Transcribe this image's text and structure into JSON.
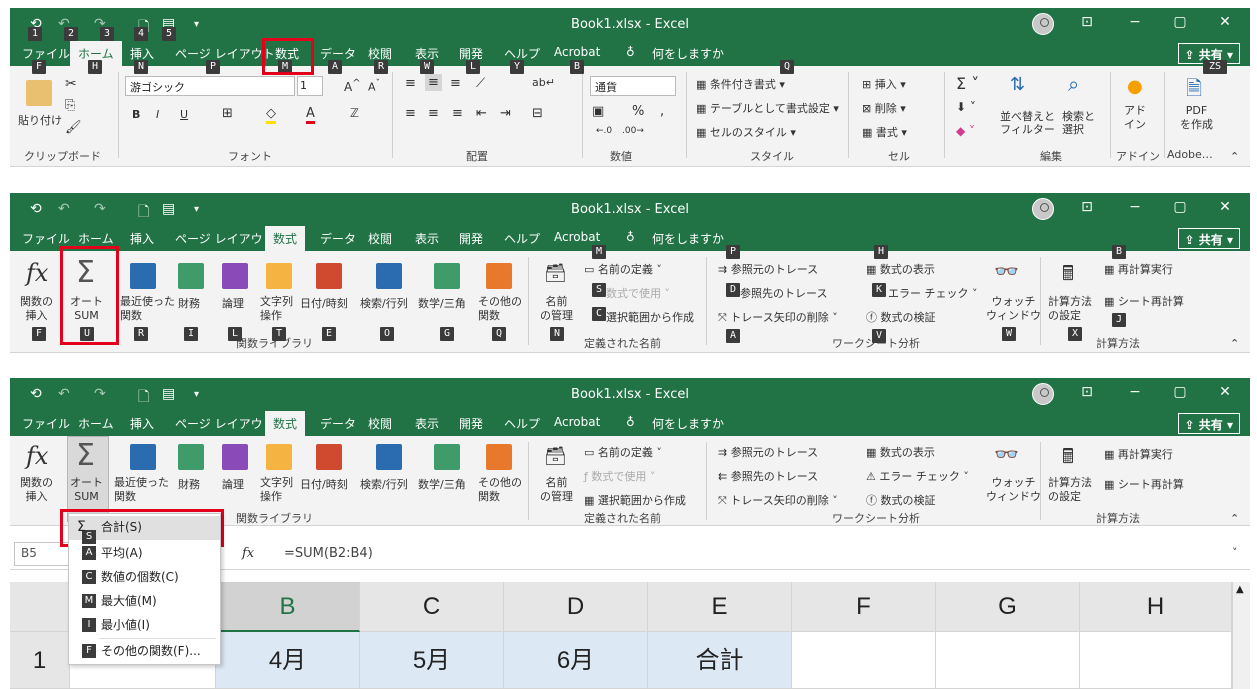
{
  "window": {
    "title": "Book1.xlsx  -  Excel",
    "minimize": "−",
    "restore": "▢",
    "close": "✕",
    "ribbon_display": "⊡",
    "share": "共有"
  },
  "tabs": [
    "ファイル",
    "ホーム",
    "挿入",
    "ページ レイアウト",
    "数式",
    "データ",
    "校閲",
    "表示",
    "開発",
    "ヘルプ",
    "Acrobat"
  ],
  "tell_me": "何をしますか",
  "home": {
    "paste": "貼り付け",
    "font_name": "游ゴシック",
    "font_size": "1",
    "number_format": "通貨",
    "cond_format": "条件付き書式",
    "table_format": "テーブルとして書式設定",
    "cell_style": "セルのスタイル",
    "insert": "挿入",
    "delete": "削除",
    "format": "書式",
    "sort_filter": "並べ替えと\nフィルター",
    "find_select": "検索と\n選択",
    "addin": "アド\nイン",
    "pdf": "PDF\nを作成",
    "groups": [
      "クリップボード",
      "フォント",
      "配置",
      "数値",
      "スタイル",
      "セル",
      "編集",
      "アドイン",
      "Adobe…"
    ],
    "keytips": {
      "file": "F",
      "home": "H",
      "insert": "N",
      "layout": "P",
      "formulas": "M",
      "data": "A",
      "review": "R",
      "view": "W",
      "dev": "L",
      "help": "Y",
      "acrobat": "B",
      "tell": "Q",
      "zs": "ZS",
      "q1": "1",
      "q2": "2",
      "q3": "3",
      "q4": "4",
      "q5": "5"
    },
    "bold": "B",
    "italic": "I",
    "underline": "U",
    "percent": "%",
    "comma": ","
  },
  "formulas": {
    "insert_function": "関数の\n挿入",
    "autosum": "オート\nSUM",
    "recent": "最近使った\n関数",
    "financial": "財務",
    "logical": "論理",
    "text": "文字列\n操作",
    "datetime": "日付/時刻",
    "lookup": "検索/行列",
    "math": "数学/三角",
    "more": "その他の\n関数",
    "name_manager": "名前\nの管理",
    "define_name": "名前の定義",
    "use_in_formula": "数式で使用",
    "create_from_sel": "選択範囲から作成",
    "trace_precedents": "参照元のトレース",
    "trace_dependents": "参照先のトレース",
    "remove_arrows": "トレース矢印の削除",
    "show_formulas": "数式の表示",
    "error_check": "エラー チェック",
    "evaluate": "数式の検証",
    "watch": "ウォッチ\nウィンドウ",
    "calc_options": "計算方法\nの設定",
    "calc_now": "再計算実行",
    "calc_sheet": "シート再計算",
    "groups": [
      "関数ライブラリ",
      "定義された名前",
      "ワークシート分析",
      "計算方法"
    ],
    "keytips": {
      "f": "F",
      "u": "U",
      "r": "R",
      "i": "I",
      "l": "L",
      "t": "T",
      "e": "E",
      "o": "O",
      "g": "G",
      "q": "Q",
      "n": "N",
      "m": "M",
      "s": "S",
      "c": "C",
      "p": "P",
      "d": "D",
      "a": "A",
      "h": "H",
      "k": "K",
      "v": "V",
      "w": "W",
      "x": "X",
      "b": "B",
      "j": "J"
    }
  },
  "formula_bar": {
    "name_box": "B5",
    "fx": "fx",
    "formula": "=SUM(B2:B4)"
  },
  "grid": {
    "columns": [
      "A",
      "B",
      "C",
      "D",
      "E",
      "F",
      "G",
      "H"
    ],
    "row1": {
      "num": "1",
      "b": "4月",
      "c": "5月",
      "d": "6月",
      "e": "合計"
    }
  },
  "autosum_menu": [
    {
      "label": "合計(S)",
      "key": "S"
    },
    {
      "label": "平均(A)",
      "key": "A"
    },
    {
      "label": "数値の個数(C)",
      "key": "C"
    },
    {
      "label": "最大値(M)",
      "key": "M"
    },
    {
      "label": "最小値(I)",
      "key": "I"
    },
    {
      "label": "その他の関数(F)...",
      "key": "F"
    }
  ],
  "colors": {
    "excel_green": "#217346",
    "highlight_red": "#e3001b",
    "keytip": "#3b3b3b"
  }
}
